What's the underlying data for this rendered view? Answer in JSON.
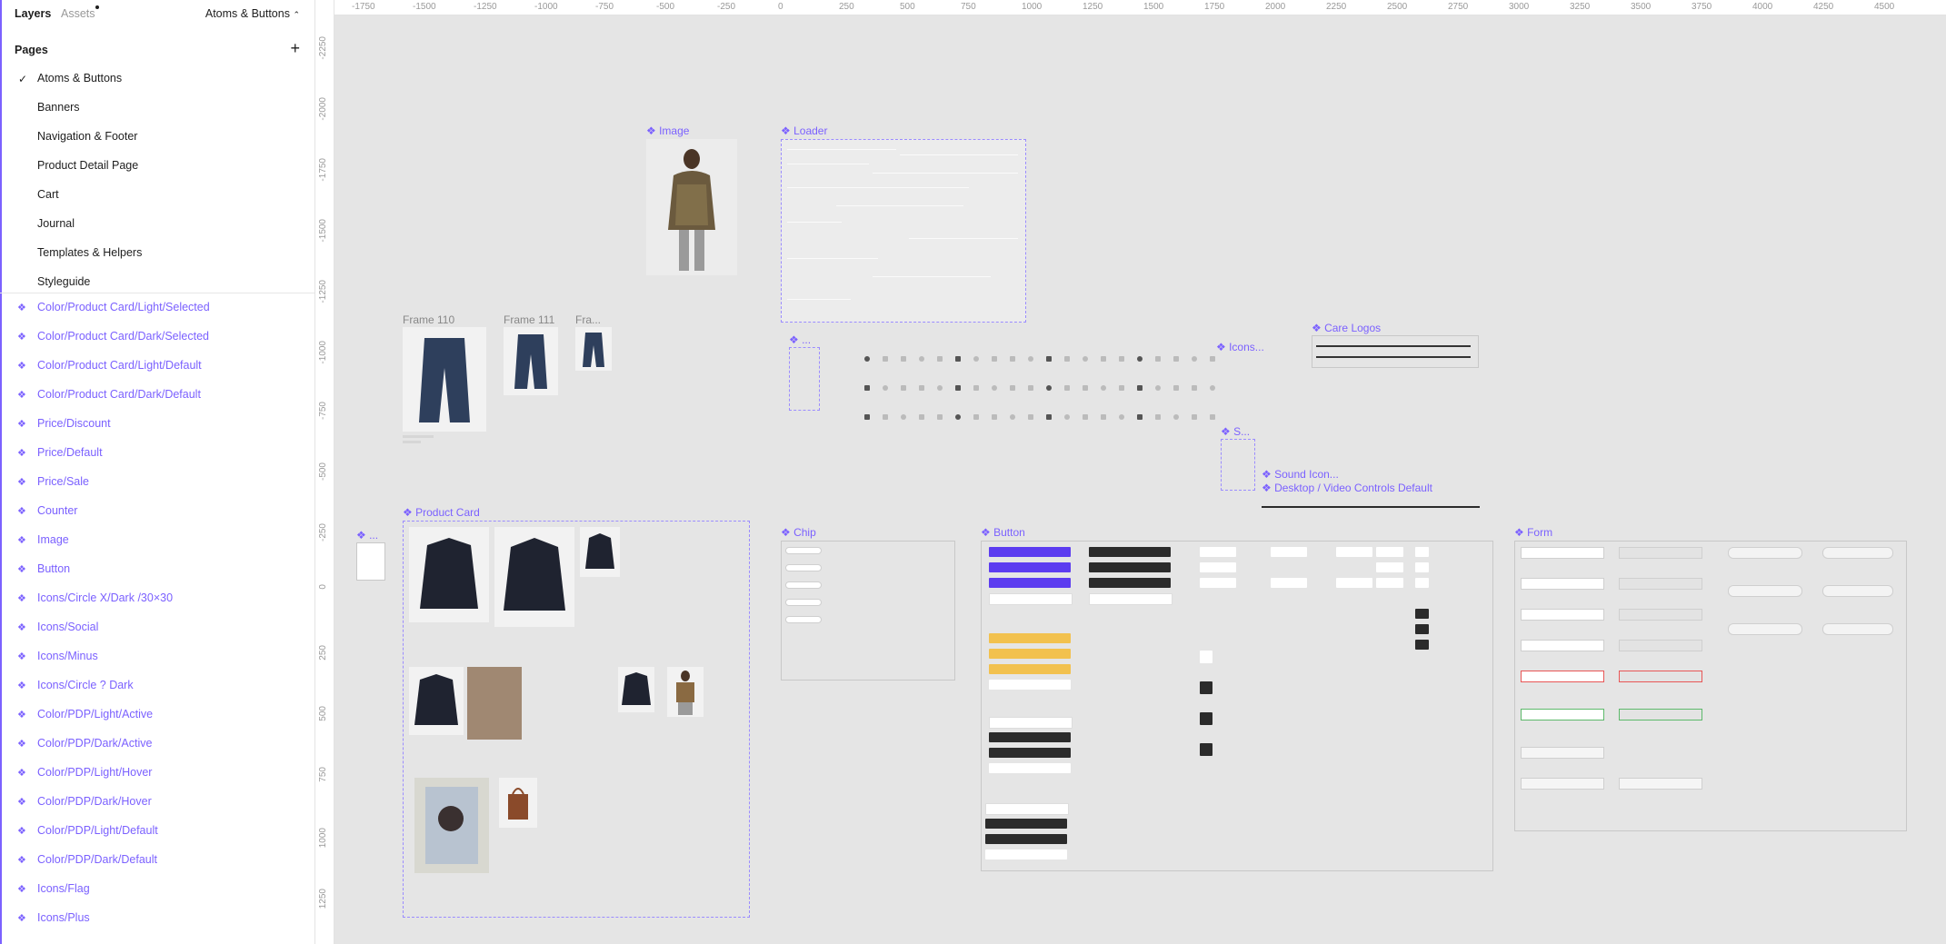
{
  "left_panel": {
    "tabs": {
      "layers": "Layers",
      "assets": "Assets"
    },
    "current_page": "Atoms & Buttons",
    "pages_title": "Pages",
    "pages": [
      "Atoms & Buttons",
      "Banners",
      "Navigation & Footer",
      "Product Detail Page",
      "Cart",
      "Journal",
      "Templates & Helpers",
      "Styleguide"
    ],
    "layers": [
      "Color/Product Card/Light/Selected",
      "Color/Product Card/Dark/Selected",
      "Color/Product Card/Light/Default",
      "Color/Product Card/Dark/Default",
      "Price/Discount",
      "Price/Default",
      "Price/Sale",
      "Counter",
      "Image",
      "Button",
      "Icons/Circle X/Dark /30×30",
      "Icons/Social",
      "Icons/Minus",
      "Icons/Circle ? Dark",
      "Color/PDP/Light/Active",
      "Color/PDP/Dark/Active",
      "Color/PDP/Light/Hover",
      "Color/PDP/Dark/Hover",
      "Color/PDP/Light/Default",
      "Color/PDP/Dark/Default",
      "Icons/Flag",
      "Icons/Plus"
    ]
  },
  "ruler": {
    "horizontal": [
      "-1750",
      "-1500",
      "-1250",
      "-1000",
      "-750",
      "-500",
      "-250",
      "0",
      "250",
      "500",
      "750",
      "1000",
      "1250",
      "1500",
      "1750",
      "2000",
      "2250",
      "2500",
      "2750",
      "3000",
      "3250",
      "3500",
      "3750",
      "4000",
      "4250",
      "4500"
    ],
    "vertical": [
      "-2250",
      "-2000",
      "-1750",
      "-1500",
      "-1250",
      "-1000",
      "-750",
      "-500",
      "-250",
      "0",
      "250",
      "500",
      "750",
      "1000",
      "1250"
    ]
  },
  "canvas": {
    "frames": {
      "image": "Image",
      "loader": "Loader",
      "frame110": "Frame 110",
      "frame111": "Frame 111",
      "frame_truncated": "Fra...",
      "dots1": "...",
      "icons": "Icons...",
      "care_logos": "Care Logos",
      "s_trunc": "S...",
      "sound_icon": "Sound Icon...",
      "video_controls": "Desktop / Video Controls Default",
      "product_card": "Product Card",
      "dots2": "...",
      "chip": "Chip",
      "button": "Button",
      "form": "Form"
    }
  },
  "colors": {
    "accent": "#7b61ff",
    "button_purple": "#5c3cf0",
    "button_dark": "#2b2b2b",
    "button_yellow": "#f2c14e"
  }
}
